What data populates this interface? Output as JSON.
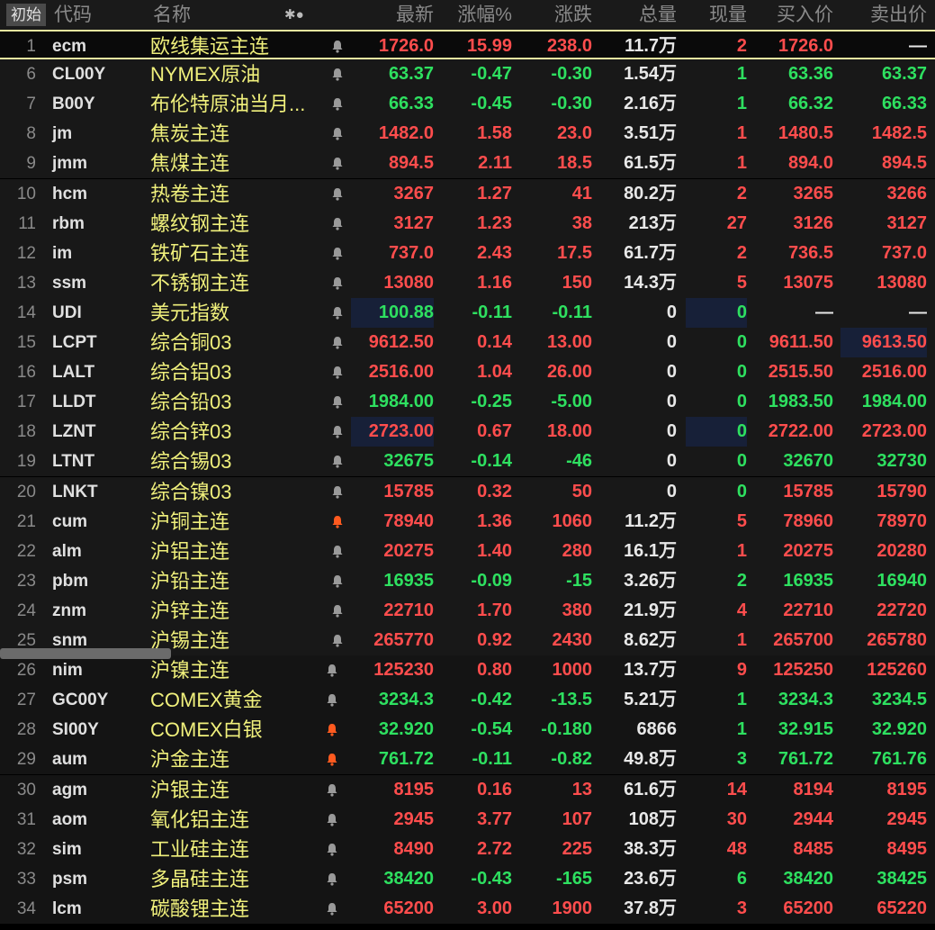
{
  "header": {
    "tab_label": "初始",
    "code": "代码",
    "name": "名称",
    "icons": "✱●",
    "last": "最新",
    "change_pct": "涨幅%",
    "change": "涨跌",
    "volume": "总量",
    "current_vol": "现量",
    "bid": "买入价",
    "ask": "卖出价"
  },
  "colors": {
    "up": "#ff4d4d",
    "down": "#2ee060",
    "name": "#f0f07c",
    "bell_active": "#ff5a1f",
    "bell": "#9a9a9a"
  },
  "rows": [
    {
      "num": "1",
      "code": "ecm",
      "name": "欧线集运主连",
      "last": "1726.0",
      "pct": "15.99",
      "chg": "238.0",
      "vol": "11.7万",
      "cur": "2",
      "bid": "1726.0",
      "ask": "—",
      "dir": "up",
      "bell": "off"
    },
    {
      "num": "6",
      "code": "CL00Y",
      "name": "NYMEX原油",
      "last": "63.37",
      "pct": "-0.47",
      "chg": "-0.30",
      "vol": "1.54万",
      "cur": "1",
      "bid": "63.36",
      "ask": "63.37",
      "dir": "dn",
      "bell": "off"
    },
    {
      "num": "7",
      "code": "B00Y",
      "name": "布伦特原油当月...",
      "last": "66.33",
      "pct": "-0.45",
      "chg": "-0.30",
      "vol": "2.16万",
      "cur": "1",
      "bid": "66.32",
      "ask": "66.33",
      "dir": "dn",
      "bell": "off"
    },
    {
      "num": "8",
      "code": "jm",
      "name": "焦炭主连",
      "last": "1482.0",
      "pct": "1.58",
      "chg": "23.0",
      "vol": "3.51万",
      "cur": "1",
      "bid": "1480.5",
      "ask": "1482.5",
      "dir": "up",
      "bell": "off"
    },
    {
      "num": "9",
      "code": "jmm",
      "name": "焦煤主连",
      "last": "894.5",
      "pct": "2.11",
      "chg": "18.5",
      "vol": "61.5万",
      "cur": "1",
      "bid": "894.0",
      "ask": "894.5",
      "dir": "up",
      "bell": "off"
    },
    {
      "num": "10",
      "code": "hcm",
      "name": "热卷主连",
      "last": "3267",
      "pct": "1.27",
      "chg": "41",
      "vol": "80.2万",
      "cur": "2",
      "bid": "3265",
      "ask": "3266",
      "dir": "up",
      "bell": "off"
    },
    {
      "num": "11",
      "code": "rbm",
      "name": "螺纹钢主连",
      "last": "3127",
      "pct": "1.23",
      "chg": "38",
      "vol": "213万",
      "cur": "27",
      "bid": "3126",
      "ask": "3127",
      "dir": "up",
      "bell": "off"
    },
    {
      "num": "12",
      "code": "im",
      "name": "铁矿石主连",
      "last": "737.0",
      "pct": "2.43",
      "chg": "17.5",
      "vol": "61.7万",
      "cur": "2",
      "bid": "736.5",
      "ask": "737.0",
      "dir": "up",
      "bell": "off"
    },
    {
      "num": "13",
      "code": "ssm",
      "name": "不锈钢主连",
      "last": "13080",
      "pct": "1.16",
      "chg": "150",
      "vol": "14.3万",
      "cur": "5",
      "bid": "13075",
      "ask": "13080",
      "dir": "up",
      "bell": "off"
    },
    {
      "num": "14",
      "code": "UDI",
      "name": "美元指数",
      "last": "100.88",
      "pct": "-0.11",
      "chg": "-0.11",
      "vol": "0",
      "cur": "0",
      "bid": "—",
      "ask": "—",
      "dir": "dn",
      "bell": "off"
    },
    {
      "num": "15",
      "code": "LCPT",
      "name": "综合铜03",
      "last": "9612.50",
      "pct": "0.14",
      "chg": "13.00",
      "vol": "0",
      "cur": "0",
      "bid": "9611.50",
      "ask": "9613.50",
      "dir": "up",
      "bell": "off"
    },
    {
      "num": "16",
      "code": "LALT",
      "name": "综合铝03",
      "last": "2516.00",
      "pct": "1.04",
      "chg": "26.00",
      "vol": "0",
      "cur": "0",
      "bid": "2515.50",
      "ask": "2516.00",
      "dir": "up",
      "bell": "off"
    },
    {
      "num": "17",
      "code": "LLDT",
      "name": "综合铅03",
      "last": "1984.00",
      "pct": "-0.25",
      "chg": "-5.00",
      "vol": "0",
      "cur": "0",
      "bid": "1983.50",
      "ask": "1984.00",
      "dir": "dn",
      "bell": "off"
    },
    {
      "num": "18",
      "code": "LZNT",
      "name": "综合锌03",
      "last": "2723.00",
      "pct": "0.67",
      "chg": "18.00",
      "vol": "0",
      "cur": "0",
      "bid": "2722.00",
      "ask": "2723.00",
      "dir": "up",
      "bell": "off"
    },
    {
      "num": "19",
      "code": "LTNT",
      "name": "综合锡03",
      "last": "32675",
      "pct": "-0.14",
      "chg": "-46",
      "vol": "0",
      "cur": "0",
      "bid": "32670",
      "ask": "32730",
      "dir": "dn",
      "bell": "off"
    },
    {
      "num": "20",
      "code": "LNKT",
      "name": "综合镍03",
      "last": "15785",
      "pct": "0.32",
      "chg": "50",
      "vol": "0",
      "cur": "0",
      "bid": "15785",
      "ask": "15790",
      "dir": "up",
      "bell": "off"
    },
    {
      "num": "21",
      "code": "cum",
      "name": "沪铜主连",
      "last": "78940",
      "pct": "1.36",
      "chg": "1060",
      "vol": "11.2万",
      "cur": "5",
      "bid": "78960",
      "ask": "78970",
      "dir": "up",
      "bell": "on"
    },
    {
      "num": "22",
      "code": "alm",
      "name": "沪铝主连",
      "last": "20275",
      "pct": "1.40",
      "chg": "280",
      "vol": "16.1万",
      "cur": "1",
      "bid": "20275",
      "ask": "20280",
      "dir": "up",
      "bell": "off"
    },
    {
      "num": "23",
      "code": "pbm",
      "name": "沪铅主连",
      "last": "16935",
      "pct": "-0.09",
      "chg": "-15",
      "vol": "3.26万",
      "cur": "2",
      "bid": "16935",
      "ask": "16940",
      "dir": "dn",
      "bell": "off"
    },
    {
      "num": "24",
      "code": "znm",
      "name": "沪锌主连",
      "last": "22710",
      "pct": "1.70",
      "chg": "380",
      "vol": "21.9万",
      "cur": "4",
      "bid": "22710",
      "ask": "22720",
      "dir": "up",
      "bell": "off"
    },
    {
      "num": "25",
      "code": "snm",
      "name": "沪锡主连",
      "last": "265770",
      "pct": "0.92",
      "chg": "2430",
      "vol": "8.62万",
      "cur": "1",
      "bid": "265700",
      "ask": "265780",
      "dir": "up",
      "bell": "off"
    },
    {
      "num": "26",
      "code": "nim",
      "name": "沪镍主连",
      "last": "125230",
      "pct": "0.80",
      "chg": "1000",
      "vol": "13.7万",
      "cur": "9",
      "bid": "125250",
      "ask": "125260",
      "dir": "up",
      "bell": "off"
    },
    {
      "num": "27",
      "code": "GC00Y",
      "name": "COMEX黄金",
      "last": "3234.3",
      "pct": "-0.42",
      "chg": "-13.5",
      "vol": "5.21万",
      "cur": "1",
      "bid": "3234.3",
      "ask": "3234.5",
      "dir": "dn",
      "bell": "off"
    },
    {
      "num": "28",
      "code": "SI00Y",
      "name": "COMEX白银",
      "last": "32.920",
      "pct": "-0.54",
      "chg": "-0.180",
      "vol": "6866",
      "cur": "1",
      "bid": "32.915",
      "ask": "32.920",
      "dir": "dn",
      "bell": "on"
    },
    {
      "num": "29",
      "code": "aum",
      "name": "沪金主连",
      "last": "761.72",
      "pct": "-0.11",
      "chg": "-0.82",
      "vol": "49.8万",
      "cur": "3",
      "bid": "761.72",
      "ask": "761.76",
      "dir": "dn",
      "bell": "on"
    },
    {
      "num": "30",
      "code": "agm",
      "name": "沪银主连",
      "last": "8195",
      "pct": "0.16",
      "chg": "13",
      "vol": "61.6万",
      "cur": "14",
      "bid": "8194",
      "ask": "8195",
      "dir": "up",
      "bell": "off"
    },
    {
      "num": "31",
      "code": "aom",
      "name": "氧化铝主连",
      "last": "2945",
      "pct": "3.77",
      "chg": "107",
      "vol": "108万",
      "cur": "30",
      "bid": "2944",
      "ask": "2945",
      "dir": "up",
      "bell": "off"
    },
    {
      "num": "32",
      "code": "sim",
      "name": "工业硅主连",
      "last": "8490",
      "pct": "2.72",
      "chg": "225",
      "vol": "38.3万",
      "cur": "48",
      "bid": "8485",
      "ask": "8495",
      "dir": "up",
      "bell": "off"
    },
    {
      "num": "33",
      "code": "psm",
      "name": "多晶硅主连",
      "last": "38420",
      "pct": "-0.43",
      "chg": "-165",
      "vol": "23.6万",
      "cur": "6",
      "bid": "38420",
      "ask": "38425",
      "dir": "dn",
      "bell": "off"
    },
    {
      "num": "34",
      "code": "lcm",
      "name": "碳酸锂主连",
      "last": "65200",
      "pct": "3.00",
      "chg": "1900",
      "vol": "37.8万",
      "cur": "3",
      "bid": "65200",
      "ask": "65220",
      "dir": "up",
      "bell": "off"
    }
  ]
}
